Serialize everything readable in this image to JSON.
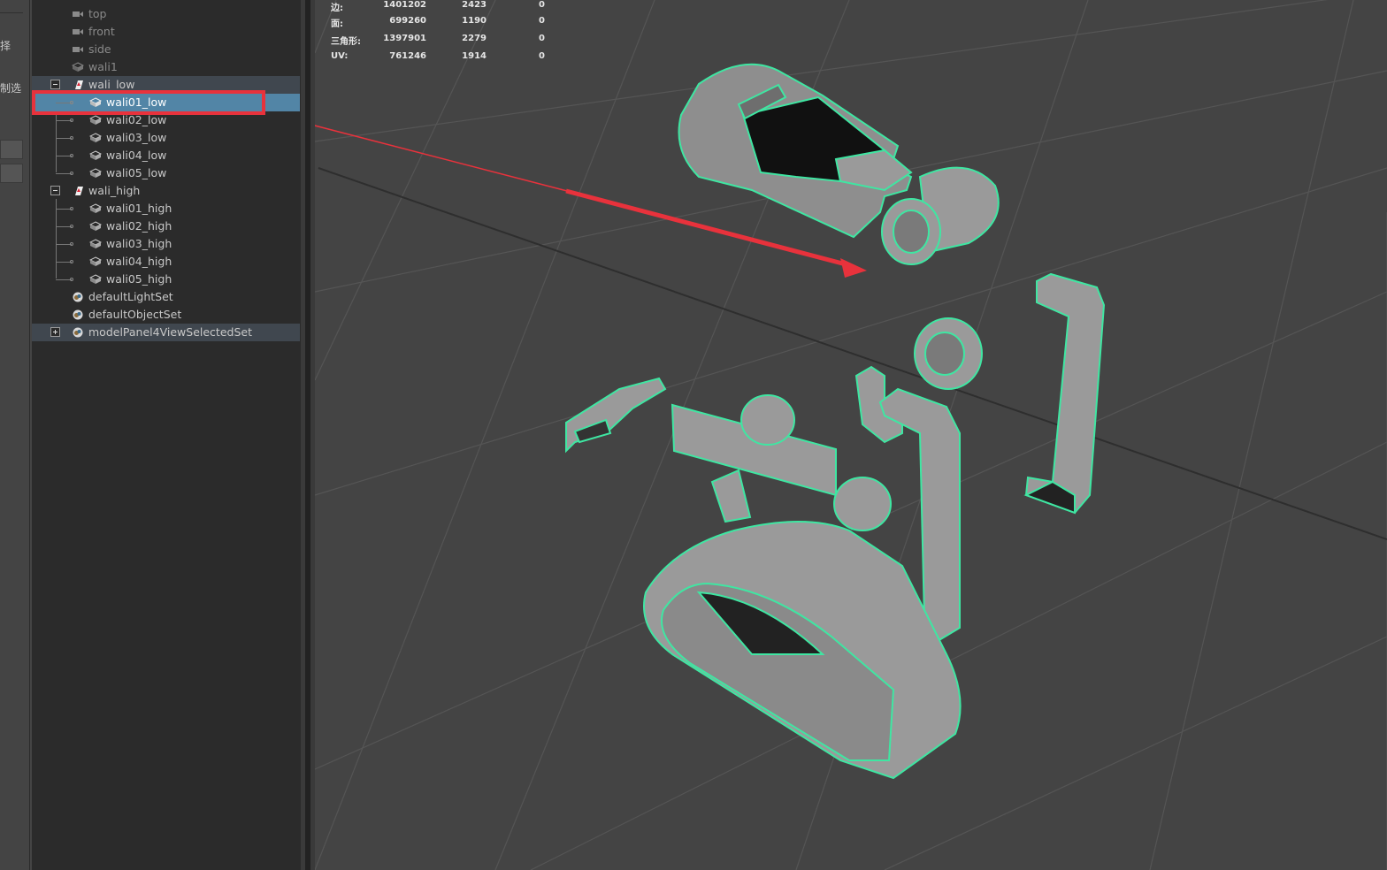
{
  "left_strip": {
    "text1": "择",
    "text2": "制选"
  },
  "outliner": {
    "items": [
      {
        "label": "top"
      },
      {
        "label": "front"
      },
      {
        "label": "side"
      },
      {
        "label": "wali1"
      },
      {
        "label": "wali_low"
      },
      {
        "label": "wali01_low"
      },
      {
        "label": "wali02_low"
      },
      {
        "label": "wali03_low"
      },
      {
        "label": "wali04_low"
      },
      {
        "label": "wali05_low"
      },
      {
        "label": "wali_high"
      },
      {
        "label": "wali01_high"
      },
      {
        "label": "wali02_high"
      },
      {
        "label": "wali03_high"
      },
      {
        "label": "wali04_high"
      },
      {
        "label": "wali05_high"
      },
      {
        "label": "defaultLightSet"
      },
      {
        "label": "defaultObjectSet"
      },
      {
        "label": "modelPanel4ViewSelectedSet"
      }
    ]
  },
  "hud": {
    "rows": [
      {
        "label": "边:",
        "a": "1401202",
        "b": "2423",
        "c": "0"
      },
      {
        "label": "面:",
        "a": "699260",
        "b": "1190",
        "c": "0"
      },
      {
        "label": "三角形:",
        "a": "1397901",
        "b": "2279",
        "c": "0"
      },
      {
        "label": "UV:",
        "a": "761246",
        "b": "1914",
        "c": "0"
      }
    ]
  },
  "colors": {
    "selection": "#5285a6",
    "annotation": "#e8323c",
    "wireframe": "#3fe6a2",
    "viewport_bg": "#444444"
  }
}
